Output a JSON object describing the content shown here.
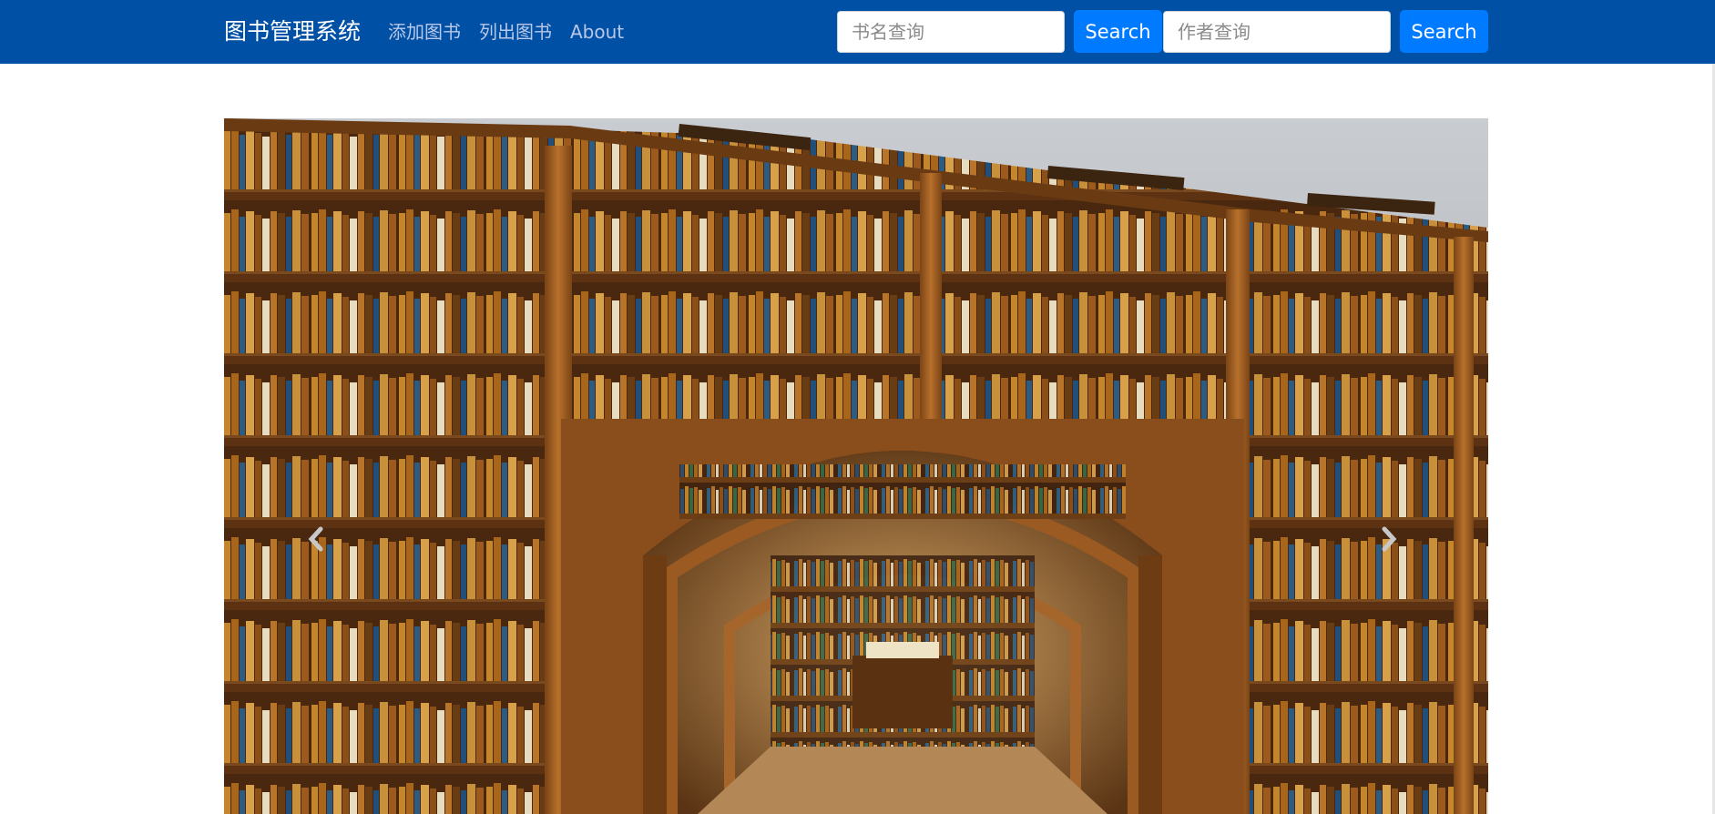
{
  "navbar": {
    "brand": "图书管理系统",
    "links": [
      "添加图书",
      "列出图书",
      "About"
    ]
  },
  "search": {
    "title_placeholder": "书名查询",
    "author_placeholder": "作者查询",
    "button_label": "Search"
  },
  "carousel": {
    "prev_icon": "chevron-left-icon",
    "next_icon": "chevron-right-icon"
  },
  "colors": {
    "navbar_bg": "#0050a6",
    "button_bg": "#007bff",
    "link": "#b9c8e8"
  }
}
